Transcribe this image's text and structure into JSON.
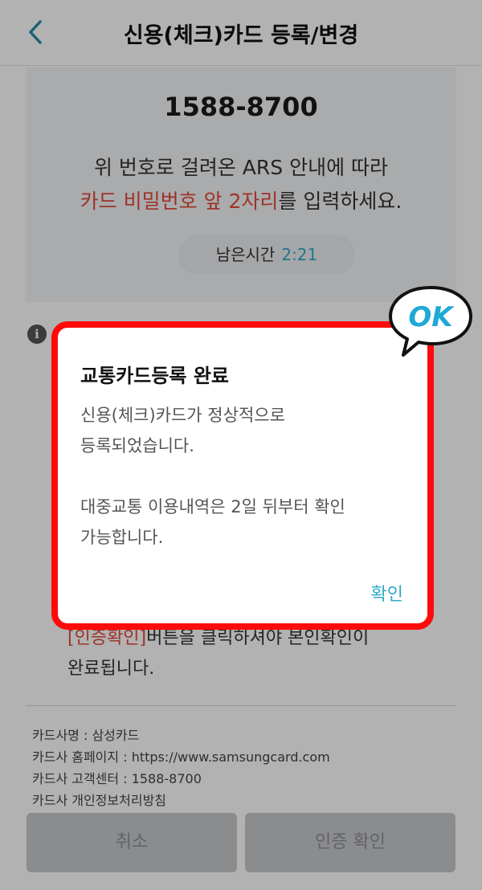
{
  "header": {
    "title": "신용(체크)카드 등록/변경",
    "back_icon": "chevron-left-icon"
  },
  "ars": {
    "phone": "1588-8700",
    "line1": "위 번호로 걸려온 ARS 안내에 따라",
    "line2_red": "카드 비밀번호 앞 2자리",
    "line2_rest": "를 입력하세요.",
    "timer_label": "남은시간",
    "timer_value": "2:21"
  },
  "notice": {
    "red": "[인증확인]",
    "line1_rest": "버튼을 클릭하셔야 본인확인이",
    "line2": "완료됩니다."
  },
  "card_info": [
    "카드사명 : 삼성카드",
    "카드사 홈페이지 : https://www.samsungcard.com",
    "카드사 고객센터 : 1588-8700",
    "카드사 개인정보처리방침"
  ],
  "buttons": {
    "cancel": "취소",
    "confirm": "인증 확인"
  },
  "dialog": {
    "title": "교통카드등록 완료",
    "body1": "신용(체크)카드가 정상적으로",
    "body2": "등록되었습니다.",
    "body3": "대중교통 이용내역은 2일 뒤부터 확인",
    "body4": "가능합니다.",
    "ok": "확인"
  },
  "sticker": {
    "text": "OK"
  },
  "colors": {
    "accent": "#2fa9c9",
    "highlight": "#e34a3a",
    "frame": "#ff0a0a"
  }
}
